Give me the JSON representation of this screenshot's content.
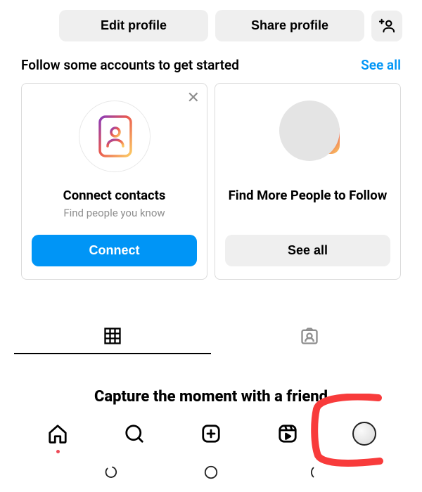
{
  "actions": {
    "edit_profile": "Edit profile",
    "share_profile": "Share profile"
  },
  "section": {
    "title": "Follow some accounts to get started",
    "see_all": "See all"
  },
  "cards": [
    {
      "title": "Connect contacts",
      "subtitle": "Find people you know",
      "button": "Connect"
    },
    {
      "title": "Find More People to Follow",
      "subtitle": "",
      "button": "See all"
    }
  ],
  "caption": "Capture the moment with a friend",
  "icons": {
    "add_person": "add-person-icon",
    "close": "close-icon",
    "contacts_book": "contacts-book-icon",
    "grid_tab": "grid-icon",
    "tagged_tab": "tagged-person-icon",
    "home": "home-icon",
    "search": "search-icon",
    "create": "create-post-icon",
    "reels": "reels-icon",
    "profile": "profile-avatar-icon",
    "sys_recent": "recent-apps-icon",
    "sys_home": "sys-home-icon",
    "sys_back": "back-icon"
  },
  "colors": {
    "link": "#0095f6",
    "primary": "#0095f6",
    "annotation": "#f83b3b"
  }
}
